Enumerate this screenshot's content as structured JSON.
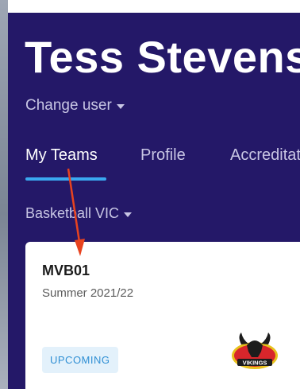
{
  "profile": {
    "name": "Tess Stevens",
    "change_user_label": "Change user"
  },
  "tabs": [
    {
      "label": "My Teams",
      "active": true
    },
    {
      "label": "Profile",
      "active": false
    },
    {
      "label": "Accreditations",
      "active": false
    }
  ],
  "org_selector": {
    "label": "Basketball VIC"
  },
  "team_card": {
    "code": "MVB01",
    "season": "Summer 2021/22",
    "status": "UPCOMING",
    "logo_text": "VIKINGS"
  },
  "colors": {
    "header_bg": "#241868",
    "tab_underline": "#3aa8f0",
    "badge_bg": "#e3f1fb",
    "badge_text": "#2f8fd4",
    "annotation_arrow": "#e8431f"
  }
}
